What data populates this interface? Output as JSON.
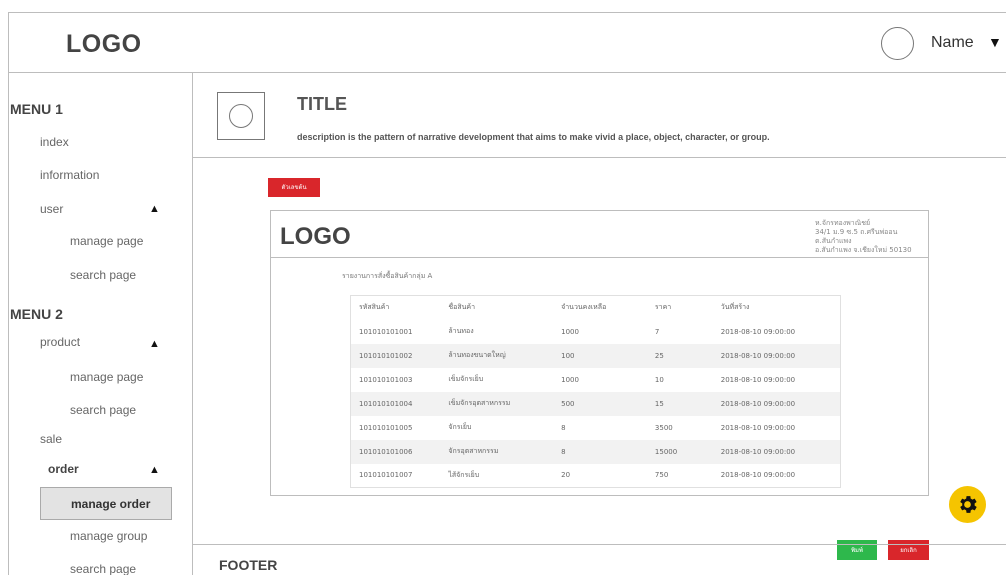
{
  "header": {
    "logo": "LOGO",
    "user_name": "Name",
    "user_caret": "▼"
  },
  "sidebar": {
    "menu1_title": "MENU 1",
    "menu1_items": [
      "index",
      "information",
      "user",
      "manage page",
      "search page"
    ],
    "menu2_title": "MENU 2",
    "menu2_items": [
      "product",
      "manage page",
      "search page",
      "sale",
      "order",
      "manage order",
      "manage group",
      "search page"
    ],
    "expand_caret": "▲"
  },
  "main": {
    "title": "TITLE",
    "description": "description is the pattern of narrative development that aims to make vivid a place, object, character, or group.",
    "red_button_label": "ตัวเลขต้น",
    "print_button_label": "พิมพ์",
    "cancel_button_label": "ยกเลิก"
  },
  "report": {
    "logo": "LOGO",
    "address_lines": [
      "ห.จักรทองพาณิชย์",
      "34/1 ม.9 ซ.5 ถ.ศรีนพ่ออน ต.สันกำแพง",
      "อ.สันกำแพง จ.เชียงใหม่ 50130"
    ],
    "subtitle": "รายงานการสั่งซื้อสินค้ากลุ่ม A",
    "columns": [
      "รหัสสินค้า",
      "ชื่อสินค้า",
      "จำนวนคงเหลือ",
      "ราคา",
      "วันที่สร้าง"
    ],
    "rows": [
      [
        "101010101001",
        "ล้านทอง",
        "1000",
        "7",
        "2018-08-10 09:00:00"
      ],
      [
        "101010101002",
        "ล้านทองขนาดใหญ่",
        "100",
        "25",
        "2018-08-10 09:00:00"
      ],
      [
        "101010101003",
        "เข็มจักรเย็บ",
        "1000",
        "10",
        "2018-08-10 09:00:00"
      ],
      [
        "101010101004",
        "เข็มจักรอุตสาหกรรม",
        "500",
        "15",
        "2018-08-10 09:00:00"
      ],
      [
        "101010101005",
        "จักรเย็บ",
        "8",
        "3500",
        "2018-08-10 09:00:00"
      ],
      [
        "101010101006",
        "จักรอุตสาหกรรม",
        "8",
        "15000",
        "2018-08-10 09:00:00"
      ],
      [
        "101010101007",
        "ไส้จักรเย็บ",
        "20",
        "750",
        "2018-08-10 09:00:00"
      ]
    ]
  },
  "footer": {
    "label": "FOOTER"
  },
  "colors": {
    "red": "#d9262b",
    "green": "#2eb84c",
    "gear": "#f5c400",
    "active_bg": "#e3e3e3"
  },
  "icons": {
    "avatar": "avatar-circle-icon",
    "settings": "gear-icon",
    "image_placeholder": "image-placeholder-icon"
  }
}
